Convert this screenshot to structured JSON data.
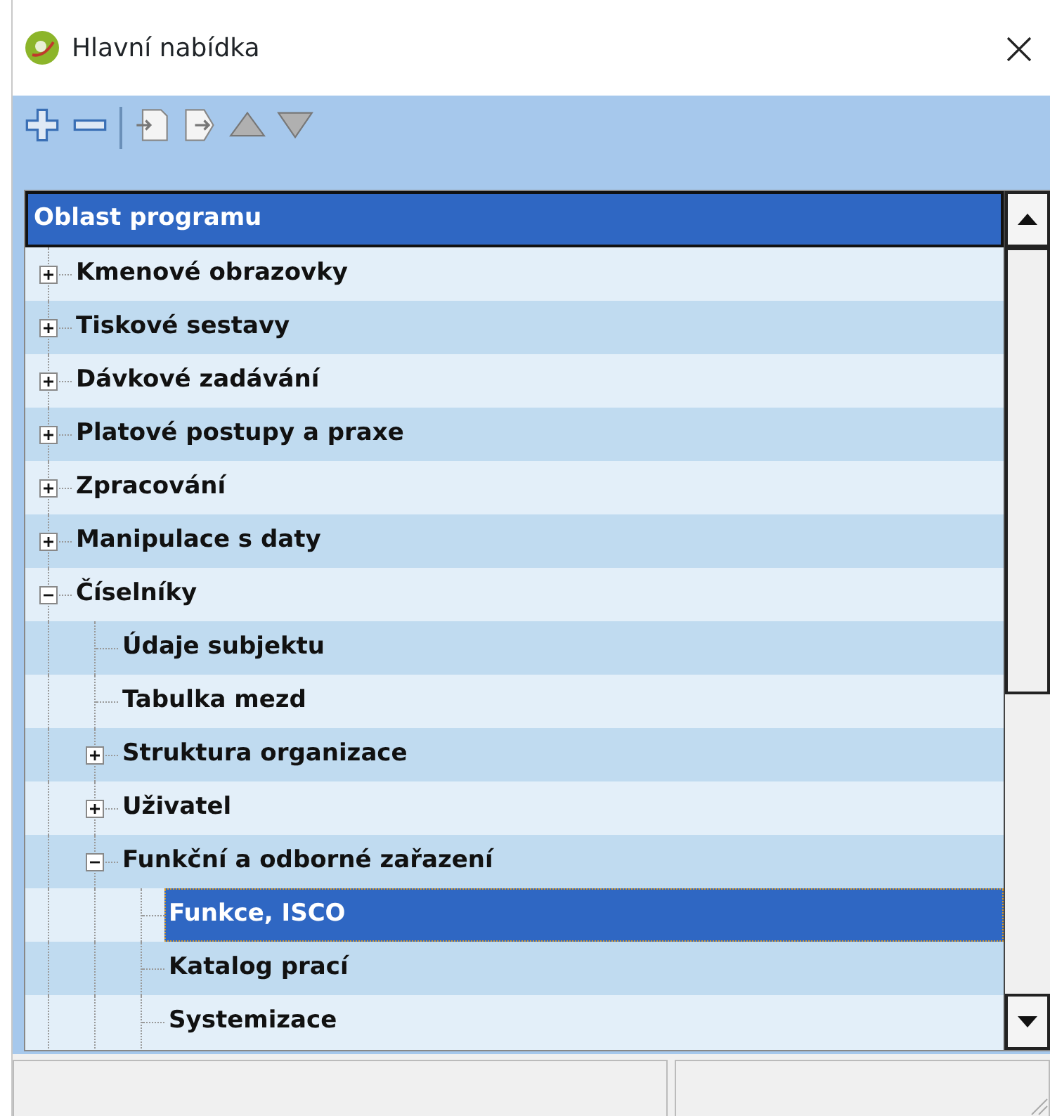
{
  "window": {
    "title": "Hlavní nabídka"
  },
  "toolbar": {
    "items": [
      {
        "kind": "plus"
      },
      {
        "kind": "minus"
      },
      {
        "kind": "separator"
      },
      {
        "kind": "doc-in"
      },
      {
        "kind": "doc-out"
      },
      {
        "kind": "up"
      },
      {
        "kind": "down"
      }
    ]
  },
  "tree": {
    "header": "Oblast programu",
    "items": [
      {
        "label": "Kmenové obrazovky",
        "expanded": false,
        "selected": false
      },
      {
        "label": "Tiskové sestavy",
        "expanded": false,
        "selected": false
      },
      {
        "label": "Dávkové zadávání",
        "expanded": false,
        "selected": false
      },
      {
        "label": "Platové postupy a praxe",
        "expanded": false,
        "selected": false
      },
      {
        "label": "Zpracování",
        "expanded": false,
        "selected": false
      },
      {
        "label": "Manipulace s daty",
        "expanded": false,
        "selected": false
      },
      {
        "label": "Číselníky",
        "expanded": true,
        "selected": false,
        "children": [
          {
            "label": "Údaje subjektu",
            "selected": false
          },
          {
            "label": "Tabulka mezd",
            "selected": false
          },
          {
            "label": "Struktura organizace",
            "expanded": false,
            "selected": false
          },
          {
            "label": "Uživatel",
            "expanded": false,
            "selected": false
          },
          {
            "label": "Funkční a odborné zařazení",
            "expanded": true,
            "selected": false,
            "children": [
              {
                "label": "Funkce, ISCO",
                "selected": true
              },
              {
                "label": "Katalog prací",
                "selected": false
              },
              {
                "label": "Systemizace",
                "selected": false
              }
            ]
          }
        ]
      }
    ]
  }
}
